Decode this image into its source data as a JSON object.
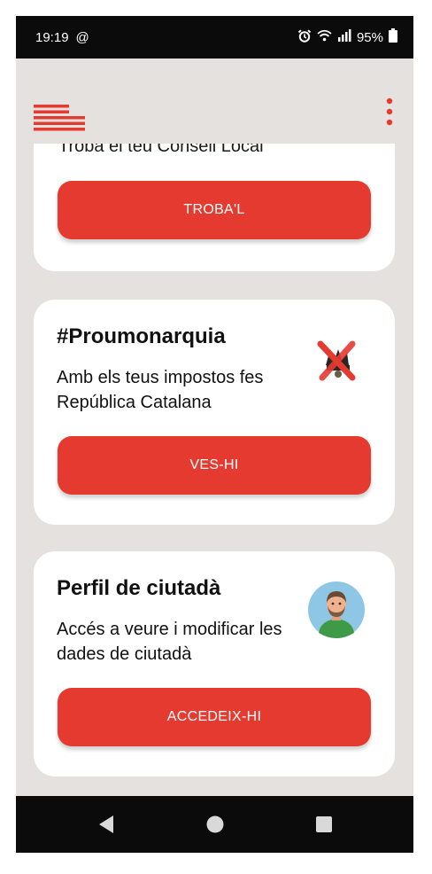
{
  "status_bar": {
    "time": "19:19",
    "at_symbol": "@",
    "battery_percent": "95%"
  },
  "header": {
    "menu_icon": "hamburger-menu-icon",
    "more_icon": "kebab-menu-icon"
  },
  "cards": [
    {
      "subtitle": "Troba el teu Consell Local",
      "button_label": "TROBA'L"
    },
    {
      "title": "#Proumonarquia",
      "description": "Amb els teus impostos fes República Catalana",
      "button_label": "VES-HI",
      "icon": "crossed-crown-icon"
    },
    {
      "title": "Perfil de ciutadà",
      "description": "Accés a veure i modificar les dades de ciutadà",
      "button_label": "ACCEDEIX-HI",
      "icon": "citizen-avatar"
    }
  ],
  "colors": {
    "accent": "#e53a30",
    "background": "#e4e1de",
    "card": "#ffffff",
    "system_bar": "#0b0b0b"
  }
}
